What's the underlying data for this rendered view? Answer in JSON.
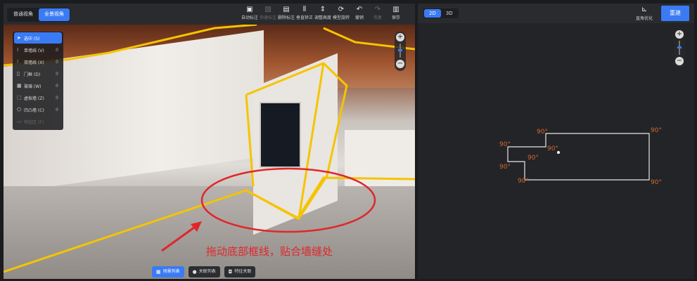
{
  "view_modes": {
    "normal": "普通视角",
    "panorama": "全景视角"
  },
  "toolbar": [
    {
      "icon": "auto-mark-icon",
      "glyph": "▣",
      "label": "自动标注",
      "disabled": false
    },
    {
      "icon": "quick-mark-icon",
      "glyph": "▧",
      "label": "快速标注",
      "disabled": true
    },
    {
      "icon": "delete-mark-icon",
      "glyph": "▤",
      "label": "删除标注",
      "disabled": false
    },
    {
      "icon": "vertical-correct-icon",
      "glyph": "⦀",
      "label": "垂直矫正",
      "disabled": false
    },
    {
      "icon": "adjust-height-icon",
      "glyph": "⇕",
      "label": "调整高度",
      "disabled": false
    },
    {
      "icon": "rotate-model-icon",
      "glyph": "⟳",
      "label": "模型旋转",
      "disabled": false
    },
    {
      "icon": "undo-icon",
      "glyph": "↶",
      "label": "撤销",
      "disabled": false
    },
    {
      "icon": "redo-icon",
      "glyph": "↷",
      "label": "恢复",
      "disabled": true
    },
    {
      "icon": "save-icon",
      "glyph": "▥",
      "label": "保存",
      "disabled": false
    }
  ],
  "sidebar": [
    {
      "icon": "cursor-icon",
      "glyph": "➤",
      "label": "选中 (S)",
      "count": "",
      "active": true,
      "dim": false
    },
    {
      "icon": "single-line-icon",
      "glyph": "⁞",
      "label": "单墙线 (V)",
      "count": "0",
      "active": false,
      "dim": false
    },
    {
      "icon": "double-line-icon",
      "glyph": "⁝",
      "label": "双墙线 (X)",
      "count": "0",
      "active": false,
      "dim": false
    },
    {
      "icon": "door-icon",
      "glyph": "▯",
      "label": "门框 (D)",
      "count": "0",
      "active": false,
      "dim": false
    },
    {
      "icon": "glass-icon",
      "glyph": "▦",
      "label": "玻璃 (W)",
      "count": "0",
      "active": false,
      "dim": false
    },
    {
      "icon": "virtual-wall-icon",
      "glyph": "⬚",
      "label": "虚拟墙 (Z)",
      "count": "0",
      "active": false,
      "dim": false
    },
    {
      "icon": "concave-convex-icon",
      "glyph": "⬠",
      "label": "凹凸墙 (C)",
      "count": "0",
      "active": false,
      "dim": false
    },
    {
      "icon": "feature-area-icon",
      "glyph": "▭",
      "label": "特征区 (F)",
      "count": "",
      "active": false,
      "dim": true
    }
  ],
  "caption": "拖动底部框线，贴合墙缝处",
  "bottom_buttons": [
    {
      "icon": "scene-list-icon",
      "glyph": "▦",
      "label": "场景列表",
      "primary": true
    },
    {
      "icon": "relation-list-icon",
      "glyph": "●",
      "label": "关联列表",
      "primary": false
    },
    {
      "icon": "feature-link-icon",
      "glyph": "◘",
      "label": "特征关联",
      "primary": false
    }
  ],
  "right": {
    "modes": {
      "d2": "2D",
      "d3": "3D"
    },
    "optimize_label": "直角优化",
    "rebuild_label": "重建",
    "angle_labels": [
      "90°",
      "90°",
      "90°",
      "90°",
      "90°",
      "90°",
      "90°",
      "90°"
    ]
  },
  "colors": {
    "accent": "#3a7bf5",
    "frame": "#f5c400",
    "caption": "#e0262b",
    "angle": "#d4682e"
  }
}
